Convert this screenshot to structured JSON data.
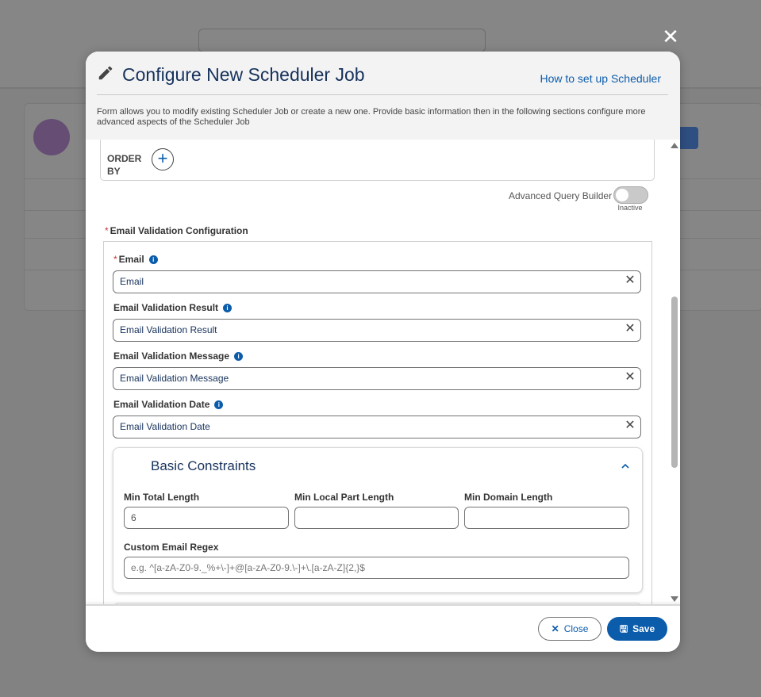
{
  "modal": {
    "title": "Configure New Scheduler Job",
    "help_link": "How to set up Scheduler",
    "description": "Form allows you to modify existing Scheduler Job or create a new one. Provide basic information then in the following sections configure more advanced aspects of the Scheduler Job",
    "close_icon": "close-icon"
  },
  "query": {
    "order_by_label": "ORDER BY",
    "add_icon": "plus-icon",
    "advanced_query_builder_label": "Advanced Query Builder",
    "advanced_query_builder_state": "Inactive"
  },
  "email_validation": {
    "section_label": "Email Validation Configuration",
    "fields": [
      {
        "label": "Email",
        "required": true,
        "value": "Email"
      },
      {
        "label": "Email Validation Result",
        "required": false,
        "value": "Email Validation Result"
      },
      {
        "label": "Email Validation Message",
        "required": false,
        "value": "Email Validation Message"
      },
      {
        "label": "Email Validation Date",
        "required": false,
        "value": "Email Validation Date"
      }
    ]
  },
  "basic_constraints": {
    "title": "Basic Constraints",
    "min_total_length_label": "Min Total Length",
    "min_total_length_value": "6",
    "min_local_part_length_label": "Min Local Part Length",
    "min_local_part_length_value": "",
    "min_domain_length_label": "Min Domain Length",
    "min_domain_length_value": "",
    "custom_regex_label": "Custom Email Regex",
    "custom_regex_placeholder": "e.g. ^[a-zA-Z0-9._%+\\-]+@[a-zA-Z0-9.\\-]+\\.[a-zA-Z]{2,}$"
  },
  "footer": {
    "close_label": "Close",
    "save_label": "Save"
  },
  "colors": {
    "brand": "#0b5cab",
    "title": "#16325c",
    "required": "#c23934"
  }
}
